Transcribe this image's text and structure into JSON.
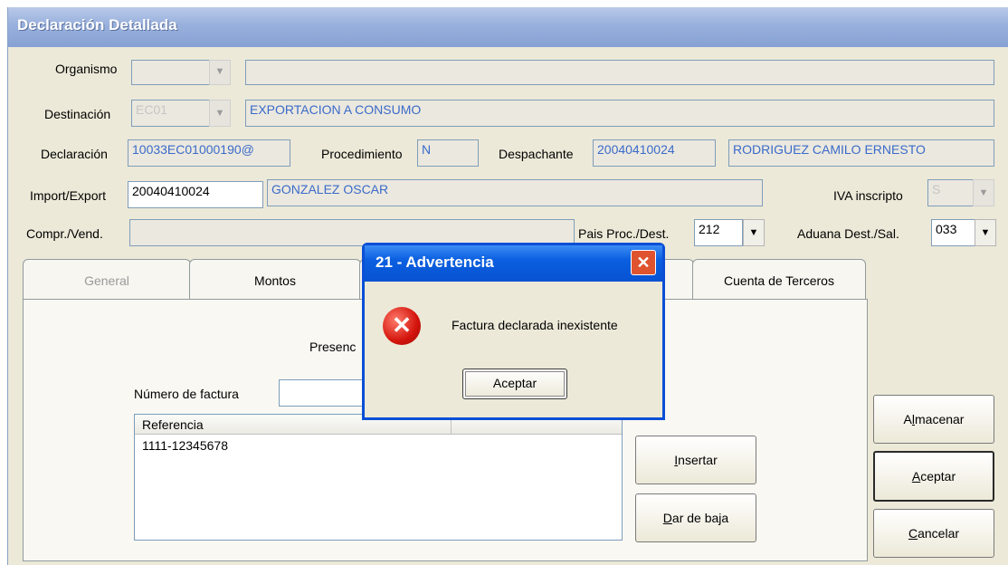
{
  "window": {
    "title": "Declaración Detallada"
  },
  "form": {
    "organismo": {
      "label": "Organismo",
      "code": "",
      "description": ""
    },
    "destinacion": {
      "label": "Destinación",
      "code": "EC01",
      "description": "EXPORTACION A CONSUMO"
    },
    "declaracion": {
      "label": "Declaración",
      "value": "10033EC01000190@"
    },
    "procedimiento": {
      "label": "Procedimiento",
      "value": "N"
    },
    "despachante": {
      "label": "Despachante",
      "code": "20040410024",
      "name": "RODRIGUEZ CAMILO ERNESTO"
    },
    "import_export": {
      "label": "Import/Export",
      "code": "20040410024",
      "name": "GONZALEZ OSCAR"
    },
    "iva_inscripto": {
      "label": "IVA inscripto",
      "value": "S"
    },
    "compr_vend": {
      "label": "Compr./Vend.",
      "value": ""
    },
    "pais": {
      "label": "Pais Proc./Dest.",
      "value": "212"
    },
    "aduana": {
      "label": "Aduana Dest./Sal.",
      "value": "033"
    }
  },
  "tabs": {
    "general": "General",
    "montos": "Montos",
    "cuenta_terceros": "Cuenta de Terceros"
  },
  "tab_content": {
    "presencia_label": "Presenc",
    "numero_factura_label": "Número de factura",
    "numero_factura_value": "",
    "table": {
      "column": "Referencia",
      "rows": [
        "1111-12345678"
      ]
    },
    "insertar": {
      "prefix": "",
      "mnemonic": "I",
      "rest": "nsertar"
    },
    "dar_de_baja": {
      "prefix": "",
      "mnemonic": "D",
      "rest": "ar de baja"
    }
  },
  "side_buttons": {
    "almacenar": {
      "prefix": "A",
      "mnemonic": "l",
      "rest": "macenar"
    },
    "aceptar": {
      "prefix": "",
      "mnemonic": "A",
      "rest": "ceptar"
    },
    "cancelar": {
      "prefix": "",
      "mnemonic": "C",
      "rest": "ancelar"
    }
  },
  "dialog": {
    "title": "21 - Advertencia",
    "message": "Factura declarada inexistente",
    "ok_label": "Aceptar",
    "icon": "error-icon",
    "close_glyph": "✕",
    "error_glyph": "✕"
  },
  "colors": {
    "title_bar": "#98b0dc",
    "dialog_title": "#0a5fe0",
    "field_text": "#3a6bc9"
  }
}
